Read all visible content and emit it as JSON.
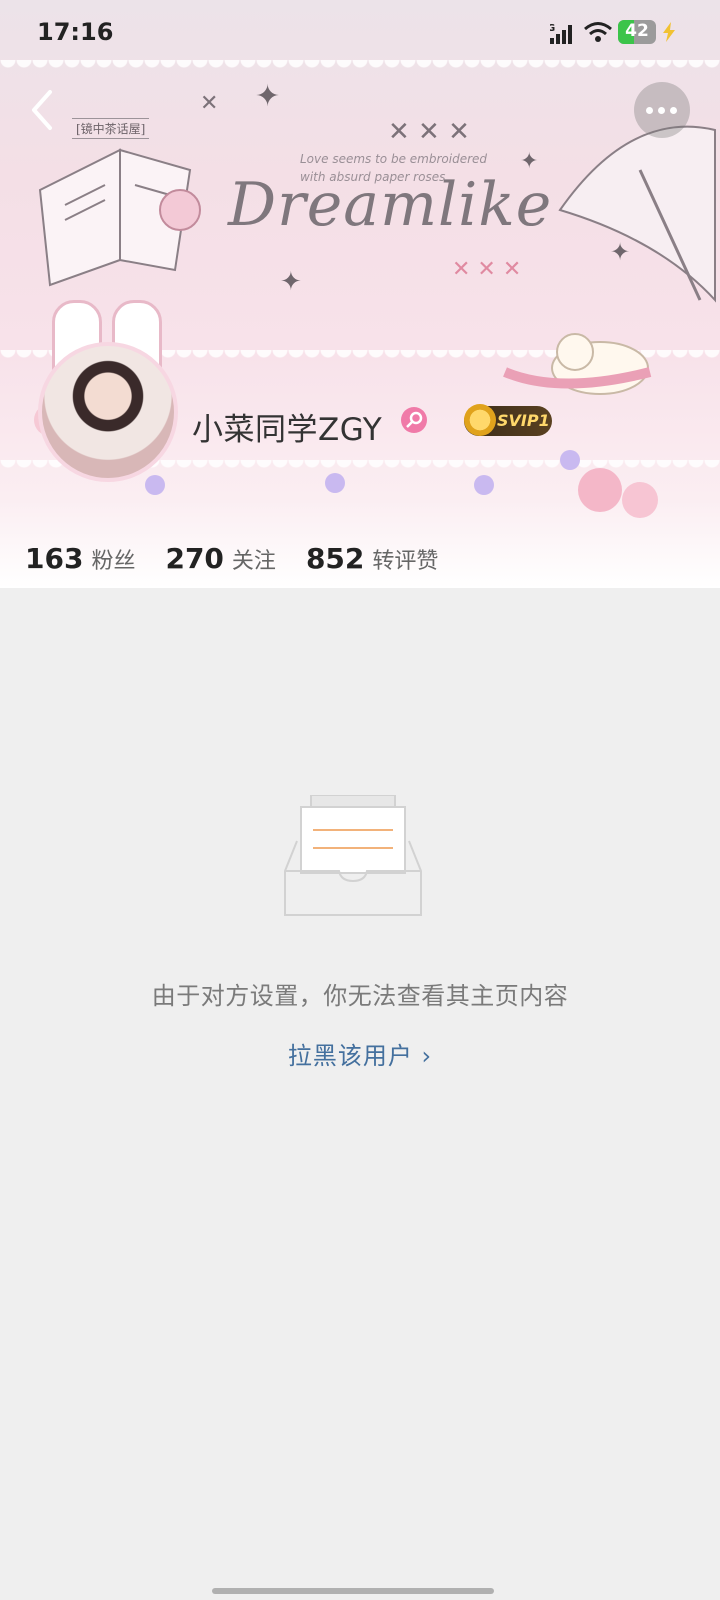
{
  "status_bar": {
    "time": "17:16",
    "network": "5G",
    "battery": "42",
    "battery_level": 0.42
  },
  "header": {
    "cover_tag": "[镜中茶话屋]",
    "cover_title": "Dreamlike",
    "cover_subtitle": "Love seems to be embroidered with absurd paper roses",
    "username": "小菜同学ZGY",
    "vip_badge": "SVIP1",
    "stats": [
      {
        "number": "163",
        "label": "粉丝"
      },
      {
        "number": "270",
        "label": "关注"
      },
      {
        "number": "852",
        "label": "转评赞"
      }
    ]
  },
  "content": {
    "message": "由于对方设置，你无法查看其主页内容",
    "block_link": "拉黑该用户 ›"
  },
  "icons": {
    "back": "chevron-left-icon",
    "more": "more-horizontal-icon",
    "gender": "female-icon",
    "empty": "empty-inbox-icon"
  },
  "colors": {
    "link": "#44709e",
    "gender_female": "#f07aa8",
    "battery_green": "#3cc44a",
    "empty_icon_lines": "#f2b27a"
  }
}
